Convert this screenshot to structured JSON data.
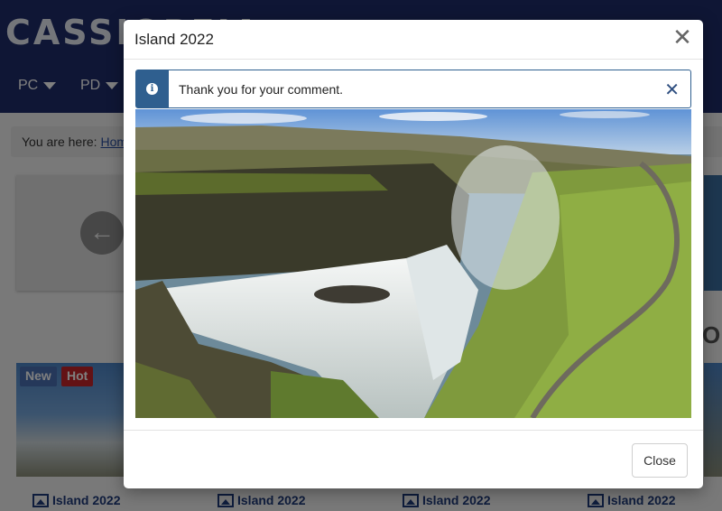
{
  "background": {
    "logo_text": "CASSIOPEIA",
    "nav_items": [
      "PC",
      "PD"
    ],
    "breadcrumb_prefix": "You are here:",
    "breadcrumb_home": "Home",
    "badges": {
      "new": "New",
      "hot": "Hot"
    },
    "captions": [
      "Island 2022",
      "Island 2022",
      "Island 2022",
      "Island 2022"
    ]
  },
  "modal": {
    "title": "Island 2022",
    "alert_message": "Thank you for your comment.",
    "close_button_label": "Close",
    "image_subject": "waterfall-canyon-photo"
  },
  "colors": {
    "header_bg": "#1f2d6b",
    "alert_accent": "#2f5f8f",
    "badge_new": "#4b71b5",
    "badge_hot": "#c7242b"
  }
}
